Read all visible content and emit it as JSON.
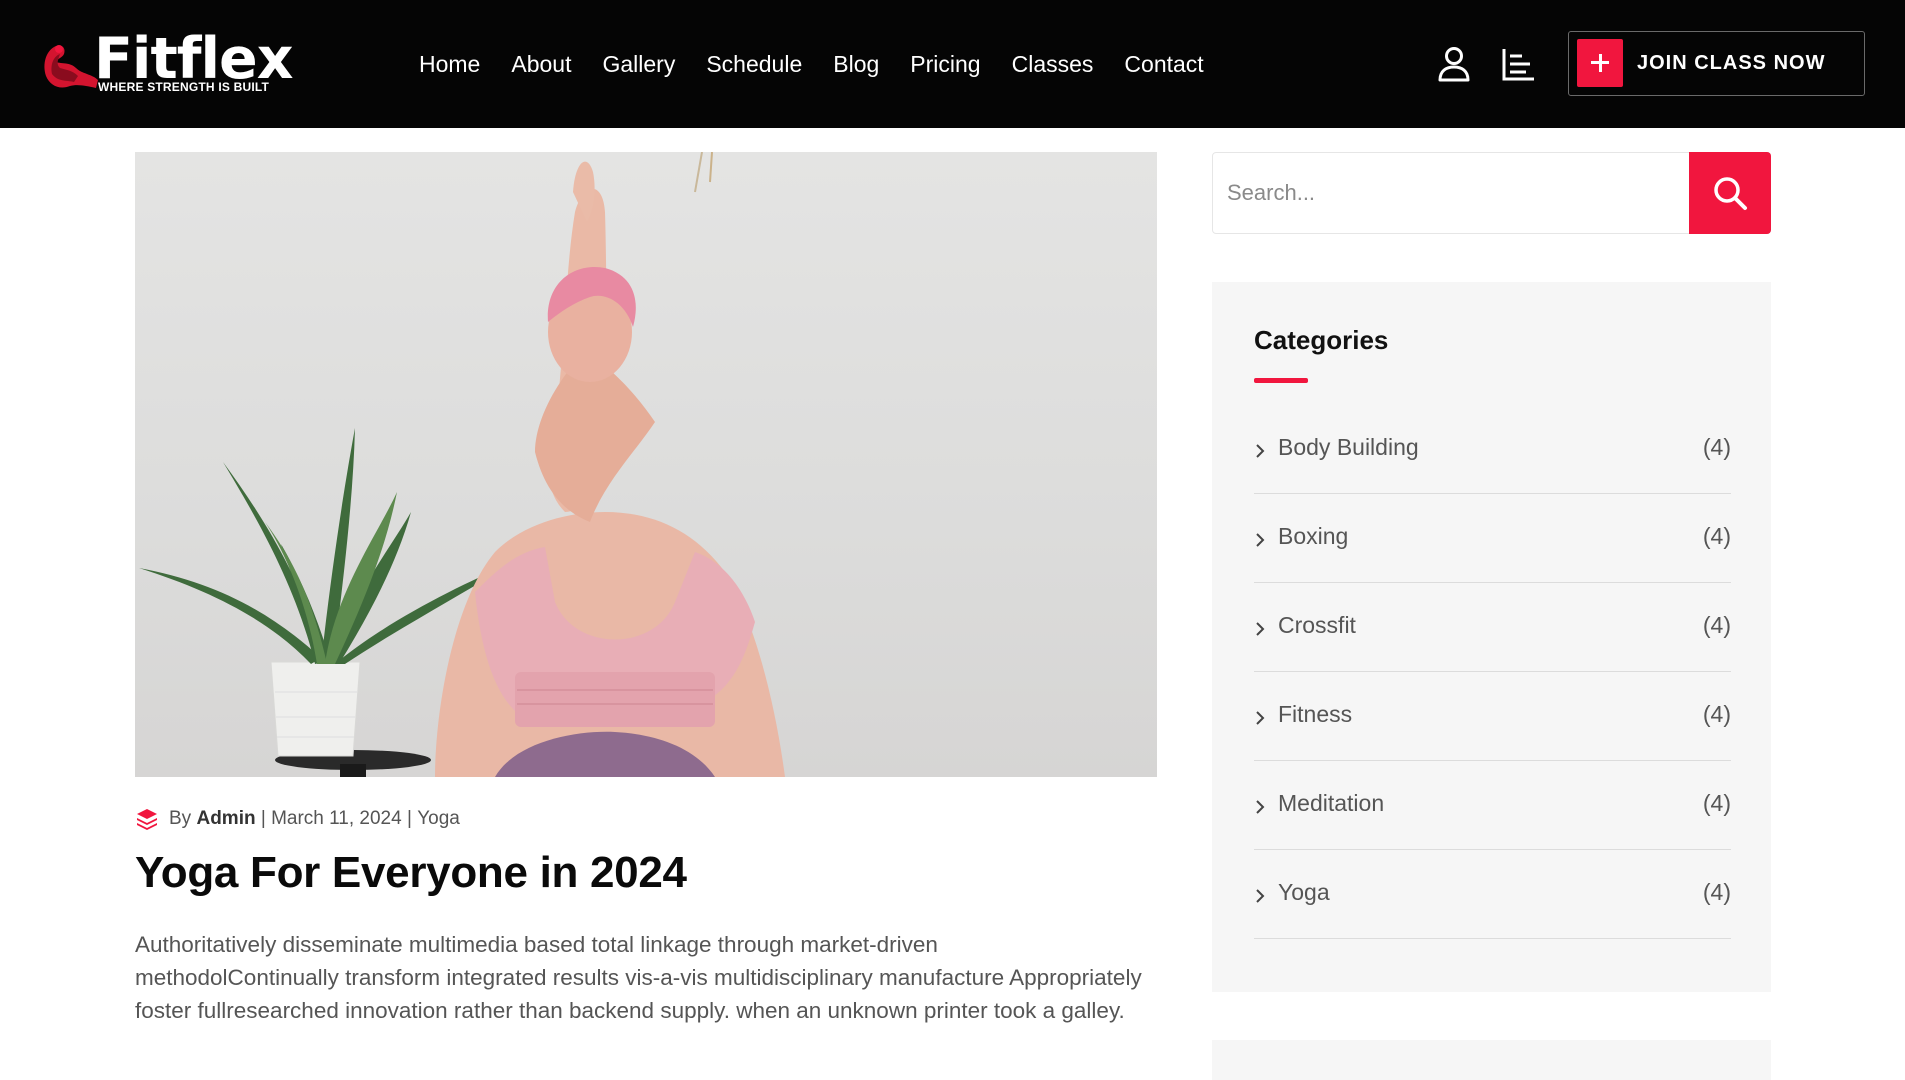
{
  "brand": {
    "name": "Fitflex",
    "tagline": "WHERE STRENGTH IS BUILT",
    "accent": "#f1163e",
    "header_bg": "#050505"
  },
  "nav": {
    "items": [
      {
        "label": "Home"
      },
      {
        "label": "About"
      },
      {
        "label": "Gallery"
      },
      {
        "label": "Schedule"
      },
      {
        "label": "Blog"
      },
      {
        "label": "Pricing"
      },
      {
        "label": "Classes"
      },
      {
        "label": "Contact"
      }
    ]
  },
  "header_actions": {
    "user_icon": "user-icon",
    "menu_icon": "bar-menu-icon",
    "join_label": "JOIN CLASS NOW"
  },
  "post": {
    "image_alt": "Woman in pink sports top doing a yoga arm pose next to an aloe plant",
    "meta": {
      "by": "By",
      "author": "Admin",
      "separator": "|",
      "date": "March 11, 2024",
      "category": "Yoga"
    },
    "title": "Yoga For Everyone in 2024",
    "excerpt": "Authoritatively disseminate multimedia based total linkage through market-driven methodolContinually transform integrated results vis-a-vis multidisciplinary manufacture Appropriately foster fullresearched innovation rather than backend supply. when an unknown printer took a galley."
  },
  "sidebar": {
    "search": {
      "placeholder": "Search...",
      "value": ""
    },
    "categories": {
      "title": "Categories",
      "items": [
        {
          "name": "Body Building",
          "count": "(4)"
        },
        {
          "name": "Boxing",
          "count": "(4)"
        },
        {
          "name": "Crossfit",
          "count": "(4)"
        },
        {
          "name": "Fitness",
          "count": "(4)"
        },
        {
          "name": "Meditation",
          "count": "(4)"
        },
        {
          "name": "Yoga",
          "count": "(4)"
        }
      ]
    }
  }
}
